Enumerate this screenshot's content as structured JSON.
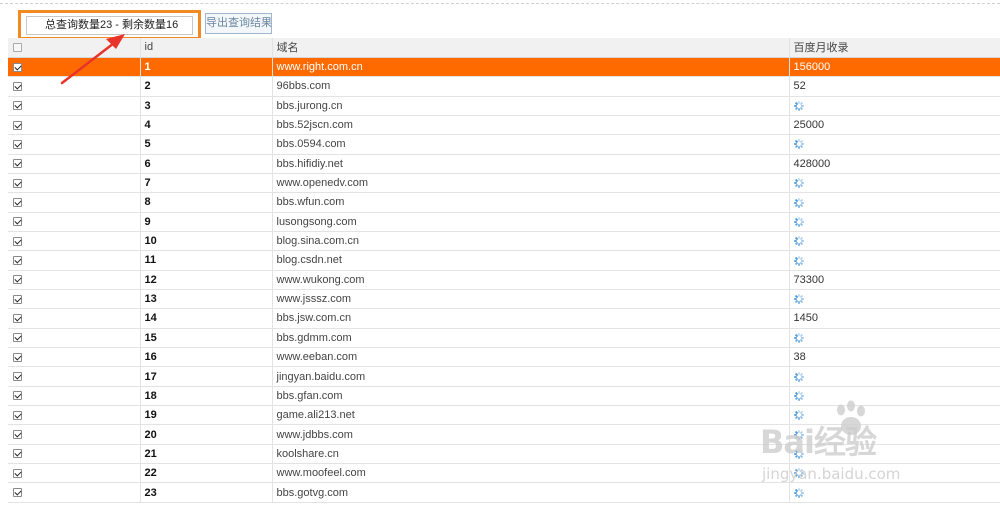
{
  "status_text": "总查询数量23 - 剩余数量16",
  "export_button": "导出查询结果",
  "columns": {
    "id": "id",
    "domain": "域名",
    "baidu": "百度月收录"
  },
  "accent_color": "#ff6a00",
  "rows": [
    {
      "id": "1",
      "domain": "www.right.com.cn",
      "baidu": "156000",
      "loading": false,
      "highlight": true
    },
    {
      "id": "2",
      "domain": "96bbs.com",
      "baidu": "52",
      "loading": false
    },
    {
      "id": "3",
      "domain": "bbs.jurong.cn",
      "baidu": "",
      "loading": true
    },
    {
      "id": "4",
      "domain": "bbs.52jscn.com",
      "baidu": "25000",
      "loading": false
    },
    {
      "id": "5",
      "domain": "bbs.0594.com",
      "baidu": "",
      "loading": true
    },
    {
      "id": "6",
      "domain": "bbs.hifidiy.net",
      "baidu": "428000",
      "loading": false
    },
    {
      "id": "7",
      "domain": "www.openedv.com",
      "baidu": "",
      "loading": true
    },
    {
      "id": "8",
      "domain": "bbs.wfun.com",
      "baidu": "",
      "loading": true
    },
    {
      "id": "9",
      "domain": "lusongsong.com",
      "baidu": "",
      "loading": true
    },
    {
      "id": "10",
      "domain": "blog.sina.com.cn",
      "baidu": "",
      "loading": true
    },
    {
      "id": "11",
      "domain": "blog.csdn.net",
      "baidu": "",
      "loading": true
    },
    {
      "id": "12",
      "domain": "www.wukong.com",
      "baidu": "73300",
      "loading": false
    },
    {
      "id": "13",
      "domain": "www.jsssz.com",
      "baidu": "",
      "loading": true
    },
    {
      "id": "14",
      "domain": "bbs.jsw.com.cn",
      "baidu": "1450",
      "loading": false
    },
    {
      "id": "15",
      "domain": "bbs.gdmm.com",
      "baidu": "",
      "loading": true
    },
    {
      "id": "16",
      "domain": "www.eeban.com",
      "baidu": "38",
      "loading": false
    },
    {
      "id": "17",
      "domain": "jingyan.baidu.com",
      "baidu": "",
      "loading": true
    },
    {
      "id": "18",
      "domain": "bbs.gfan.com",
      "baidu": "",
      "loading": true
    },
    {
      "id": "19",
      "domain": "game.ali213.net",
      "baidu": "",
      "loading": true
    },
    {
      "id": "20",
      "domain": "www.jdbbs.com",
      "baidu": "",
      "loading": true
    },
    {
      "id": "21",
      "domain": "koolshare.cn",
      "baidu": "",
      "loading": true
    },
    {
      "id": "22",
      "domain": "www.moofeel.com",
      "baidu": "",
      "loading": true
    },
    {
      "id": "23",
      "domain": "bbs.gotvg.com",
      "baidu": "",
      "loading": true
    }
  ],
  "watermark": {
    "brand": "Bai经验",
    "site": "jingyan.baidu.com"
  },
  "icons": {
    "row_loading": "loading-spinner-icon",
    "annotation": "red-arrow-icon"
  }
}
